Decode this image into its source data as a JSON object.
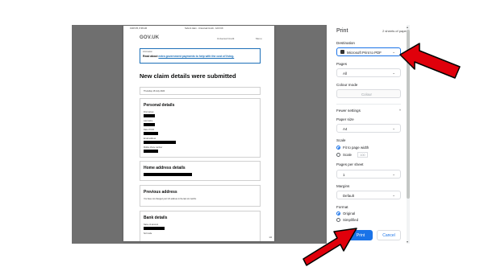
{
  "preview": {
    "header_left": "19/07/25, 8:38 AM",
    "header_center": "Submit claim - Universal Credit - GOV.UK",
    "logo": "GOV.UK",
    "service": "Universal Credit",
    "menu": "Menu",
    "banner_tag": "Information",
    "banner_prefix": "Read about ",
    "banner_link": "extra government payments to help with the cost of living.",
    "heading": "New claim details were submitted",
    "date": "Thursday 18 July 2024",
    "sections": {
      "personal": "Personal details",
      "home": "Home address details",
      "previous": "Previous address",
      "bank": "Bank details"
    },
    "personal_fields": [
      "First names",
      "Last name",
      "Date of birth",
      "Email address",
      "Mobile phone number"
    ],
    "previous_text": "You have not changed your UK address in the last six months",
    "bank_fields": [
      "Name of account",
      "Sort code"
    ],
    "page_number": "1/4"
  },
  "dialog": {
    "title": "Print",
    "sheets": "2 sheets of paper",
    "destination_label": "Destination",
    "destination_value": "Microsoft Print to PDF",
    "pages_label": "Pages",
    "pages_value": "All",
    "colour_label": "Colour mode",
    "colour_value": "Colour",
    "fewer_settings": "Fewer settings",
    "paper_size_label": "Paper size",
    "paper_size_value": "A4",
    "scale_label": "Scale",
    "scale_fit": "Fit to page width",
    "scale_custom": "Scale",
    "scale_value": "100",
    "pages_per_sheet_label": "Pages per sheet",
    "pages_per_sheet_value": "1",
    "margins_label": "Margins",
    "margins_value": "Default",
    "format_label": "Format",
    "format_original": "Original",
    "format_simplified": "Simplified",
    "print_button": "Print",
    "cancel_button": "Cancel"
  },
  "colors": {
    "accent": "#1a73e8",
    "arrow": "#e0000b",
    "preview_bg": "#6f6f6f",
    "govuk_link": "#1d70b8"
  }
}
